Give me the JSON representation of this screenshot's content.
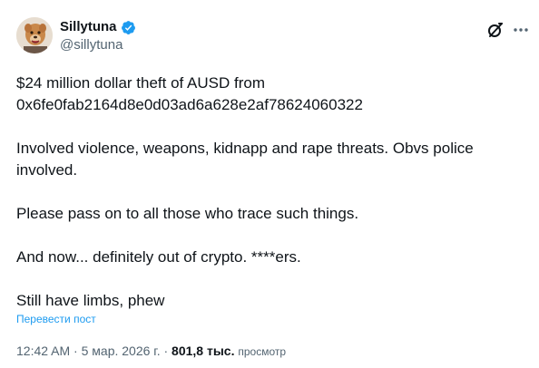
{
  "author": {
    "display_name": "Sillytuna",
    "handle": "@sillytuna",
    "verified_color": "#1d9bf0"
  },
  "icons": {
    "verified": "verified-badge-icon",
    "grok": "grok-icon",
    "more": "more-options-icon",
    "avatar": "avatar-image"
  },
  "tweet": {
    "lines": [
      "$24 million dollar theft of AUSD from",
      "0x6fe0fab2164d8e0d03ad6a628e2af78624060322",
      "",
      "Involved violence, weapons, kidnapp and rape threats. Obvs police",
      "involved.",
      "",
      "Please pass on to all those who trace such things.",
      "",
      "And now... definitely out of crypto. ****ers.",
      "",
      "Still have limbs, phew"
    ],
    "translate_label": "Перевести пост"
  },
  "meta": {
    "time": "12:42 AM",
    "separator": "·",
    "date": "5 мар. 2026 г.",
    "separator2": "·",
    "views_count": "801,8 тыс.",
    "views_label": "просмотр"
  }
}
